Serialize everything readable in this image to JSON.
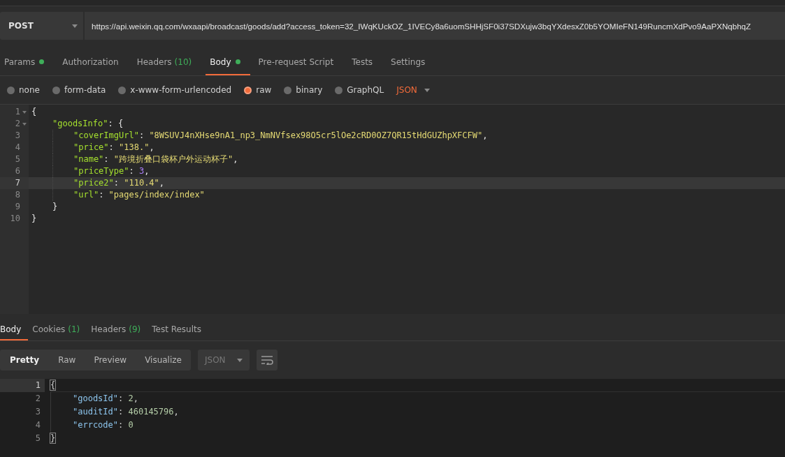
{
  "request": {
    "method": "POST",
    "url": "https://api.weixin.qq.com/wxaapi/broadcast/goods/add?access_token=32_IWqKUckOZ_1IVECy8a6uomSHHjSF0i37SDXujw3bqYXdesxZ0b5YOMIeFN149RuncmXdPvo9AaPXNqbhqZ"
  },
  "request_tabs": [
    {
      "label": "Params",
      "selected": false,
      "dot": true
    },
    {
      "label": "Authorization",
      "selected": false,
      "dot": false
    },
    {
      "label": "Headers",
      "count": "(10)",
      "selected": false,
      "dot": false
    },
    {
      "label": "Body",
      "selected": true,
      "dot": true
    },
    {
      "label": "Pre-request Script",
      "selected": false,
      "dot": false
    },
    {
      "label": "Tests",
      "selected": false,
      "dot": false
    },
    {
      "label": "Settings",
      "selected": false,
      "dot": false
    }
  ],
  "body_types": [
    {
      "label": "none",
      "selected": false
    },
    {
      "label": "form-data",
      "selected": false
    },
    {
      "label": "x-www-form-urlencoded",
      "selected": false
    },
    {
      "label": "raw",
      "selected": true
    },
    {
      "label": "binary",
      "selected": false
    },
    {
      "label": "GraphQL",
      "selected": false
    }
  ],
  "raw_format": "JSON",
  "request_body": [
    {
      "number": "1",
      "foldable": true,
      "current": false,
      "tokens": [
        {
          "kind": "punct",
          "text": "{"
        }
      ],
      "children": [
        {
          "number": "2",
          "foldable": true,
          "current": false,
          "tokens": [
            {
              "kind": "key",
              "text": "\"goodsInfo\""
            },
            {
              "kind": "punct",
              "text": ": {"
            }
          ],
          "children": [
            {
              "number": "3",
              "foldable": false,
              "current": false,
              "tokens": [
                {
                  "kind": "key",
                  "text": "\"coverImgUrl\""
                },
                {
                  "kind": "punct",
                  "text": ": "
                },
                {
                  "kind": "string",
                  "text": "\"8WSUVJ4nXHse9nA1_np3_NmNVfsex98O5cr5lOe2cRD0OZ7QR15tHdGUZhpXFCFW\""
                },
                {
                  "kind": "punct",
                  "text": ","
                }
              ]
            },
            {
              "number": "4",
              "foldable": false,
              "current": false,
              "tokens": [
                {
                  "kind": "key",
                  "text": "\"price\""
                },
                {
                  "kind": "punct",
                  "text": ": "
                },
                {
                  "kind": "string",
                  "text": "\"138.\""
                },
                {
                  "kind": "punct",
                  "text": ","
                }
              ]
            },
            {
              "number": "5",
              "foldable": false,
              "current": false,
              "tokens": [
                {
                  "kind": "key",
                  "text": "\"name\""
                },
                {
                  "kind": "punct",
                  "text": ": "
                },
                {
                  "kind": "string",
                  "text": "\"跨境折叠口袋杯户外运动杯子\""
                },
                {
                  "kind": "punct",
                  "text": ","
                }
              ]
            },
            {
              "number": "6",
              "foldable": false,
              "current": false,
              "tokens": [
                {
                  "kind": "key",
                  "text": "\"priceType\""
                },
                {
                  "kind": "punct",
                  "text": ": "
                },
                {
                  "kind": "number",
                  "text": "3"
                },
                {
                  "kind": "punct",
                  "text": ","
                }
              ]
            },
            {
              "number": "7",
              "foldable": false,
              "current": true,
              "tokens": [
                {
                  "kind": "key",
                  "text": "\"price2\""
                },
                {
                  "kind": "punct",
                  "text": ": "
                },
                {
                  "kind": "string",
                  "text": "\"110.4\""
                },
                {
                  "kind": "punct",
                  "text": ","
                }
              ]
            },
            {
              "number": "8",
              "foldable": false,
              "current": false,
              "tokens": [
                {
                  "kind": "key",
                  "text": "\"url\""
                },
                {
                  "kind": "punct",
                  "text": ": "
                },
                {
                  "kind": "string",
                  "text": "\"pages/index/index\""
                }
              ]
            }
          ]
        },
        {
          "number": "9",
          "foldable": false,
          "current": false,
          "tokens": [
            {
              "kind": "punct",
              "text": "}"
            }
          ]
        }
      ]
    },
    {
      "number": "10",
      "foldable": false,
      "current": false,
      "tokens": [
        {
          "kind": "punct",
          "text": "}"
        }
      ]
    }
  ],
  "response_tabs": [
    {
      "label": "Body",
      "selected": true
    },
    {
      "label": "Cookies",
      "count": "(1)",
      "selected": false
    },
    {
      "label": "Headers",
      "count": "(9)",
      "selected": false
    },
    {
      "label": "Test Results",
      "selected": false
    }
  ],
  "view_modes": [
    {
      "label": "Pretty",
      "selected": true
    },
    {
      "label": "Raw",
      "selected": false
    },
    {
      "label": "Preview",
      "selected": false
    },
    {
      "label": "Visualize",
      "selected": false
    }
  ],
  "response_format": {
    "label": "JSON",
    "disabled": true
  },
  "response_body": [
    {
      "number": "1",
      "current": true,
      "tokens": [
        {
          "kind": "bracket-match",
          "text": "{"
        }
      ],
      "children": [
        {
          "number": "2",
          "current": false,
          "tokens": [
            {
              "kind": "key",
              "text": "\"goodsId\""
            },
            {
              "kind": "punct",
              "text": ": "
            },
            {
              "kind": "number",
              "text": "2"
            },
            {
              "kind": "punct",
              "text": ","
            }
          ]
        },
        {
          "number": "3",
          "current": false,
          "tokens": [
            {
              "kind": "key",
              "text": "\"auditId\""
            },
            {
              "kind": "punct",
              "text": ": "
            },
            {
              "kind": "number",
              "text": "460145796"
            },
            {
              "kind": "punct",
              "text": ","
            }
          ]
        },
        {
          "number": "4",
          "current": false,
          "tokens": [
            {
              "kind": "key",
              "text": "\"errcode\""
            },
            {
              "kind": "punct",
              "text": ": "
            },
            {
              "kind": "number",
              "text": "0"
            }
          ]
        }
      ]
    },
    {
      "number": "5",
      "current": false,
      "tokens": [
        {
          "kind": "bracket-match",
          "text": "}"
        }
      ]
    }
  ]
}
